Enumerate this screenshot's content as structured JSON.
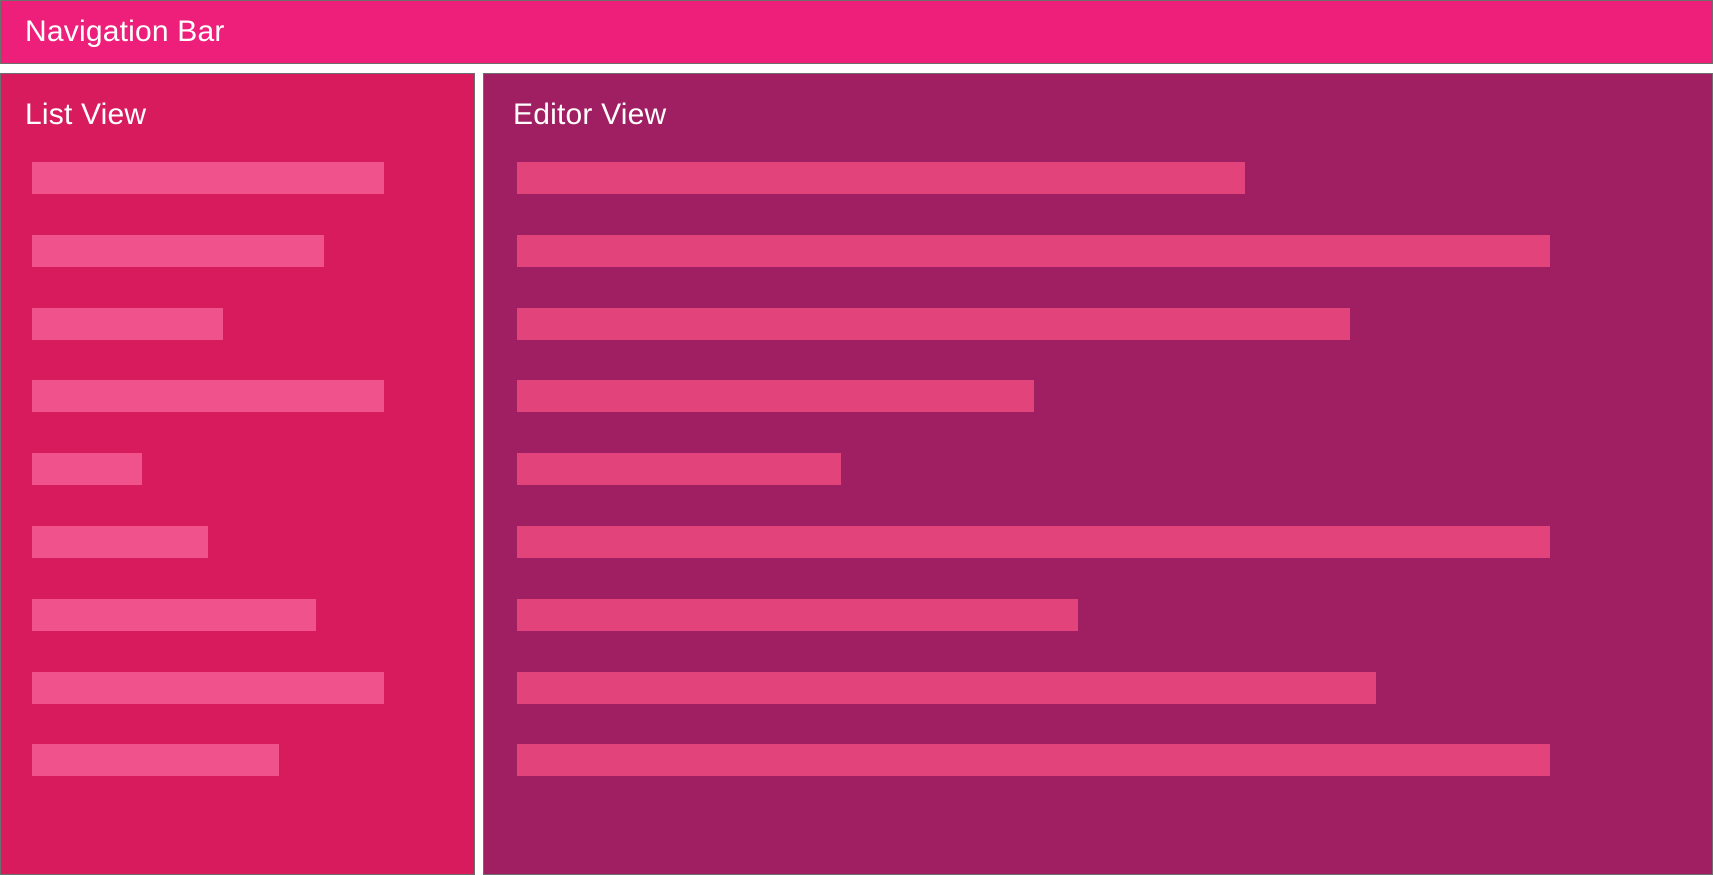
{
  "navigation_bar": {
    "label": "Navigation Bar",
    "color": "#ee1f7b"
  },
  "list_view": {
    "label": "List View",
    "color": "#d81b5c",
    "item_color": "#f0528b",
    "items": [
      {
        "fill": 0.74
      },
      {
        "fill": 0.615
      },
      {
        "fill": 0.402
      },
      {
        "fill": 0.74
      },
      {
        "fill": 0.232
      },
      {
        "fill": 0.37
      },
      {
        "fill": 0.597
      },
      {
        "fill": 0.74
      },
      {
        "fill": 0.521
      }
    ]
  },
  "editor_view": {
    "label": "Editor View",
    "color": "#a01e62",
    "item_color": "#e2437b",
    "items": [
      {
        "fill": 0.5915
      },
      {
        "fill": 0.84
      },
      {
        "fill": 0.677
      },
      {
        "fill": 0.42
      },
      {
        "fill": 0.2635
      },
      {
        "fill": 0.84
      },
      {
        "fill": 0.456
      },
      {
        "fill": 0.698
      },
      {
        "fill": 0.84
      }
    ]
  }
}
